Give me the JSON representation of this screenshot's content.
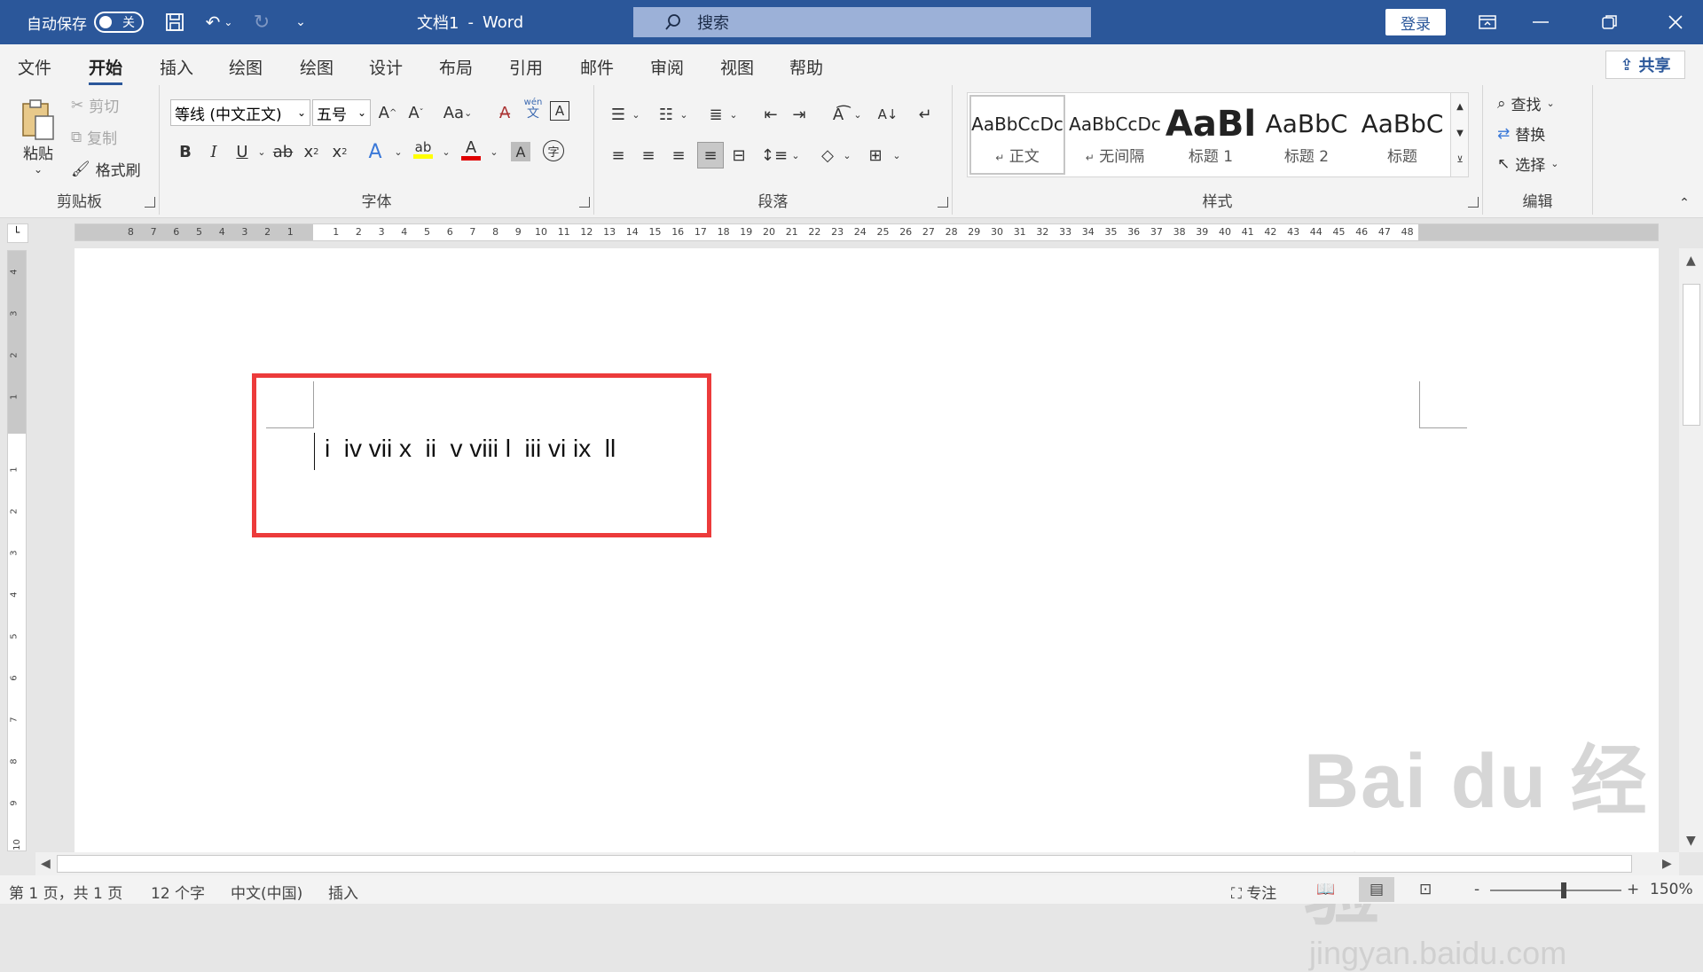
{
  "titlebar": {
    "autosave_label": "自动保存",
    "autosave_state": "关",
    "doc_title": "文档1",
    "separator": "-",
    "app_name": "Word",
    "search_placeholder": "搜索",
    "login_label": "登录"
  },
  "menu": {
    "items": [
      "文件",
      "开始",
      "插入",
      "绘图",
      "绘图",
      "设计",
      "布局",
      "引用",
      "邮件",
      "审阅",
      "视图",
      "帮助"
    ],
    "active_index": 1,
    "share_label": "共享"
  },
  "ribbon": {
    "clipboard": {
      "label": "剪贴板",
      "paste": "粘贴",
      "cut": "剪切",
      "copy": "复制",
      "format_painter": "格式刷"
    },
    "font": {
      "label": "字体",
      "font_name": "等线 (中文正文)",
      "font_size": "五号",
      "grow": "A",
      "shrink": "A",
      "case": "Aa",
      "phonetic_top": "wén",
      "phonetic_bottom": "文",
      "bold": "B",
      "italic": "I",
      "underline": "U",
      "strike": "ab",
      "sub": "x",
      "sup": "x",
      "sub_mark": "2",
      "sup_mark": "2",
      "effects": "A",
      "highlight": "ab",
      "font_color": "A",
      "shading": "A",
      "enclose": "字"
    },
    "paragraph": {
      "label": "段落"
    },
    "styles": {
      "label": "样式",
      "tiles": [
        {
          "sample": "AaBbCcDc",
          "name": "正文",
          "mark": "↵"
        },
        {
          "sample": "AaBbCcDc",
          "name": "无间隔",
          "mark": "↵"
        },
        {
          "sample": "AaBl",
          "name": "标题 1",
          "mark": ""
        },
        {
          "sample": "AaBbC",
          "name": "标题 2",
          "mark": ""
        },
        {
          "sample": "AaBbC",
          "name": "标题",
          "mark": ""
        }
      ]
    },
    "editing": {
      "label": "编辑",
      "find": "查找",
      "replace": "替换",
      "select": "选择"
    }
  },
  "ruler": {
    "left_numbers": [
      "8",
      "7",
      "6",
      "5",
      "4",
      "3",
      "2",
      "1"
    ],
    "right_numbers": [
      "1",
      "2",
      "3",
      "4",
      "5",
      "6",
      "7",
      "8",
      "9",
      "10",
      "11",
      "12",
      "13",
      "14",
      "15",
      "16",
      "17",
      "18",
      "19",
      "20",
      "21",
      "22",
      "23",
      "24",
      "25",
      "26",
      "27",
      "28",
      "29",
      "30",
      "31",
      "32",
      "33",
      "34",
      "35",
      "36",
      "37",
      "38",
      "39",
      "40",
      "41",
      "42",
      "43",
      "44",
      "45",
      "46",
      "47",
      "48"
    ],
    "vertical_top": [
      "4",
      "3",
      "2",
      "1"
    ],
    "vertical_bottom": [
      "1",
      "2",
      "3",
      "4",
      "5",
      "6",
      "7",
      "8",
      "9",
      "10"
    ]
  },
  "document": {
    "text": "i  iv vii x  ii  v viii l  iii vi ix  ll"
  },
  "statusbar": {
    "page": "第 1 页，共 1 页",
    "words": "12 个字",
    "language": "中文(中国)",
    "mode": "插入",
    "focus": "专注",
    "zoom_minus": "-",
    "zoom_plus": "+",
    "zoom": "150%",
    "zoom_fraction": 0.56
  },
  "watermark": {
    "line1": "Bai du 经验",
    "line2": "jingyan.baidu.com"
  },
  "colors": {
    "titlebar": "#2b579a",
    "highlight_box": "#ec3b3b",
    "font_color_bar": "#e00000",
    "highlight_bar": "#ffff00"
  }
}
